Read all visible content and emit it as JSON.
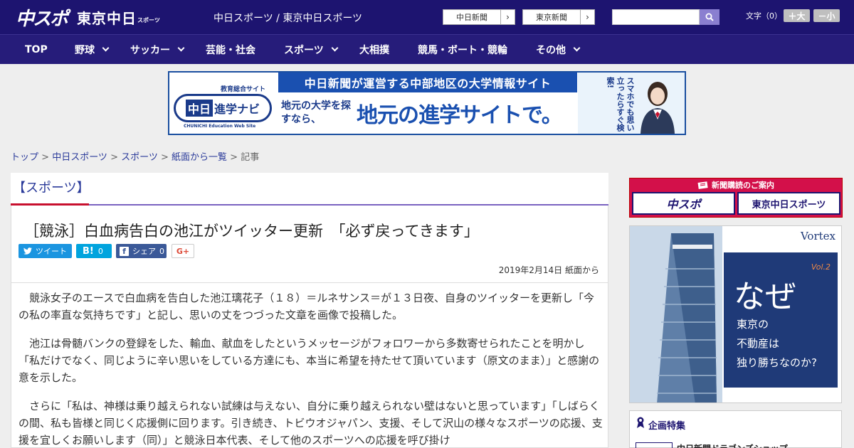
{
  "header": {
    "logo_main": "中スポ",
    "logo_sub": "東京中日",
    "logo_sports": "スポーツ",
    "site_title": "中日スポーツ / 東京中日スポーツ",
    "ext_links": [
      "中日新聞",
      "東京新聞"
    ],
    "search_placeholder": "",
    "font_size_label": "文字（0）",
    "font_up": "＋大",
    "font_down": "－小"
  },
  "nav": [
    {
      "label": "TOP",
      "dropdown": false
    },
    {
      "label": "野球",
      "dropdown": true
    },
    {
      "label": "サッカー",
      "dropdown": true
    },
    {
      "label": "芸能・社会",
      "dropdown": false
    },
    {
      "label": "スポーツ",
      "dropdown": true
    },
    {
      "label": "大相撲",
      "dropdown": false
    },
    {
      "label": "競馬・ボート・競輪",
      "dropdown": false
    },
    {
      "label": "その他",
      "dropdown": true
    }
  ],
  "banner": {
    "sub": "教育総合サイト",
    "logo": [
      "中日",
      "進学ナビ"
    ],
    "logo_en": "CHUNICHI Education Web Site",
    "top": "中日新聞が運営する中部地区の大学情報サイト",
    "small": "地元の大学を探すなら、",
    "big": "地元の進学サイトで。",
    "vertical": "スマホでも思い立ったらすぐ検索!"
  },
  "breadcrumb": {
    "items": [
      "トップ",
      "中日スポーツ",
      "スポーツ",
      "紙面から一覧"
    ],
    "current": "記事",
    "sep": " > "
  },
  "article": {
    "section": "【スポーツ】",
    "headline": "［競泳］白血病告白の池江がツイッター更新　「必ず戻ってきます」",
    "share": {
      "tweet": "ツイート",
      "hatena_count": "0",
      "facebook": "シェア",
      "facebook_count": "0",
      "gplus": "G+"
    },
    "meta": "2019年2月14日 紙面から",
    "paragraphs": [
      "競泳女子のエースで白血病を告白した池江璃花子（１８）＝ルネサンス＝が１３日夜、自身のツイッターを更新し「今の私の率直な気持ちです」と記し、思いの丈をつづった文章を画像で投稿した。",
      "池江は骨髄バンクの登録をした、輸血、献血をしたというメッセージがフォロワーから多数寄せられたことを明かし「私だけでなく、同じように辛い思いをしている方達にも、本当に希望を持たせて頂いています（原文のまま）」と感謝の意を示した。",
      "さらに「私は、神様は乗り越えられない試練は与えない、自分に乗り越えられない壁はないと思っています」「しばらくの間、私も皆様と同じく応援側に回ります。引き続き、トビウオジャパン、支援、そして沢山の様々なスポーツの応援、支援を宜しくお願いします（同）」と競泳日本代表、そして他のスポーツへの応援を呼び掛け"
    ]
  },
  "sidebar": {
    "subscribe_title": "新聞購読のご案内",
    "subscribe_buttons": [
      "中スポ",
      "東京中日スポーツ"
    ],
    "ad": {
      "brand": "Vortex",
      "vol": "Vol.2",
      "headline": "なぜ",
      "lines": [
        "東京の",
        "不動産は",
        "独り勝ちなのか?"
      ]
    },
    "feature_title": "企画特集",
    "feature_item": "中日新聞ドラゴンズショップ"
  },
  "colors": {
    "header_bg": "#1d1470",
    "nav_bg": "#261c7a",
    "link": "#2a3a9a",
    "accent_red": "#c8102e",
    "accent_purple": "#7a62c0",
    "twitter": "#1b95e0",
    "hatena": "#00a4de",
    "facebook": "#3b5998"
  }
}
